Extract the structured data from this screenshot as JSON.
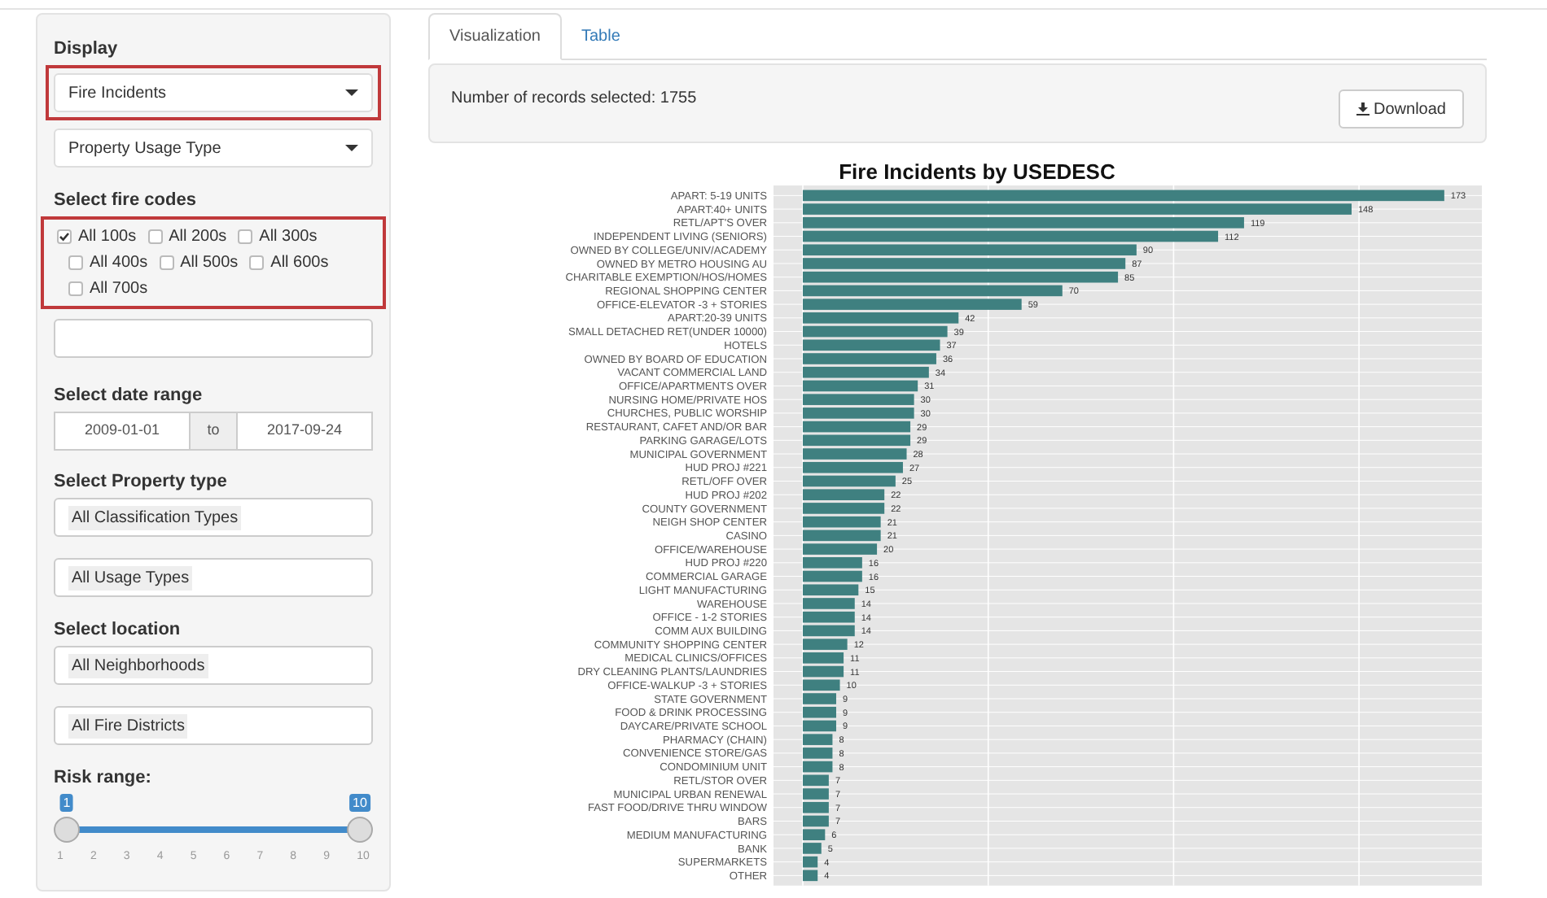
{
  "sidebar": {
    "display": {
      "label": "Display",
      "selects": [
        {
          "value": "Fire Incidents",
          "highlighted": true
        },
        {
          "value": "Property Usage Type",
          "highlighted": false
        }
      ]
    },
    "fire_codes": {
      "label": "Select fire codes",
      "highlighted": true,
      "options": [
        {
          "label": "All 100s",
          "checked": true
        },
        {
          "label": "All 200s",
          "checked": false
        },
        {
          "label": "All 300s",
          "checked": false
        },
        {
          "label": "All 400s",
          "checked": false
        },
        {
          "label": "All 500s",
          "checked": false
        },
        {
          "label": "All 600s",
          "checked": false
        },
        {
          "label": "All 700s",
          "checked": false
        }
      ]
    },
    "date_range": {
      "label": "Select date range",
      "start": "2009-01-01",
      "separator": "to",
      "end": "2017-09-24"
    },
    "property_type": {
      "label": "Select Property type",
      "fields": [
        "All Classification Types",
        "All Usage Types"
      ]
    },
    "location": {
      "label": "Select location",
      "fields": [
        "All Neighborhoods",
        "All Fire Districts"
      ]
    },
    "risk": {
      "label": "Risk range:",
      "handles": [
        {
          "label": "1",
          "level": 0
        },
        {
          "label": "10",
          "level": 1
        }
      ],
      "ticks": [
        "1",
        "2",
        "3",
        "4",
        "5",
        "6",
        "7",
        "8",
        "9",
        "10"
      ]
    }
  },
  "tabs": [
    {
      "label": "Visualization",
      "selected": true
    },
    {
      "label": "Table",
      "selected": false
    }
  ],
  "summary": {
    "text": "Number of records selected: 1755",
    "download": "Download"
  },
  "chart_data": {
    "type": "bar",
    "orientation": "horizontal",
    "grid": true,
    "title": "Fire Incidents by USEDESC",
    "data_labels": true,
    "categories": [
      "APART: 5-19 UNITS",
      "APART:40+ UNITS",
      "RETL/APT'S OVER",
      "INDEPENDENT LIVING (SENIORS)",
      "OWNED BY COLLEGE/UNIV/ACADEMY",
      "OWNED BY METRO HOUSING AU",
      "CHARITABLE EXEMPTION/HOS/HOMES",
      "REGIONAL SHOPPING CENTER",
      "OFFICE-ELEVATOR -3 + STORIES",
      "APART:20-39 UNITS",
      "SMALL DETACHED RET(UNDER 10000)",
      "HOTELS",
      "OWNED BY BOARD OF EDUCATION",
      "VACANT COMMERCIAL LAND",
      "OFFICE/APARTMENTS OVER",
      "NURSING HOME/PRIVATE HOS",
      "CHURCHES, PUBLIC WORSHIP",
      "RESTAURANT, CAFET AND/OR BAR",
      "PARKING GARAGE/LOTS",
      "MUNICIPAL GOVERNMENT",
      "HUD PROJ #221",
      "RETL/OFF OVER",
      "HUD PROJ #202",
      "COUNTY GOVERNMENT",
      "NEIGH SHOP CENTER",
      "CASINO",
      "OFFICE/WAREHOUSE",
      "HUD PROJ #220",
      "COMMERCIAL GARAGE",
      "LIGHT MANUFACTURING",
      "WAREHOUSE",
      "OFFICE - 1-2 STORIES",
      "COMM AUX BUILDING",
      "COMMUNITY SHOPPING CENTER",
      "MEDICAL CLINICS/OFFICES",
      "DRY CLEANING PLANTS/LAUNDRIES",
      "OFFICE-WALKUP -3 + STORIES",
      "STATE GOVERNMENT",
      "FOOD & DRINK PROCESSING",
      "DAYCARE/PRIVATE SCHOOL",
      "PHARMACY (CHAIN)",
      "CONVENIENCE STORE/GAS",
      "CONDOMINIUM UNIT",
      "RETL/STOR OVER",
      "MUNICIPAL URBAN RENEWAL",
      "FAST FOOD/DRIVE THRU WINDOW",
      "BARS",
      "MEDIUM MANUFACTURING",
      "BANK",
      "SUPERMARKETS",
      "OTHER"
    ],
    "values": [
      173,
      148,
      119,
      112,
      90,
      87,
      85,
      70,
      59,
      42,
      39,
      37,
      36,
      34,
      31,
      30,
      30,
      29,
      29,
      28,
      27,
      25,
      22,
      22,
      21,
      21,
      20,
      16,
      16,
      15,
      14,
      14,
      14,
      12,
      11,
      11,
      10,
      9,
      9,
      9,
      8,
      8,
      8,
      7,
      7,
      7,
      7,
      6,
      5,
      4,
      4
    ]
  }
}
